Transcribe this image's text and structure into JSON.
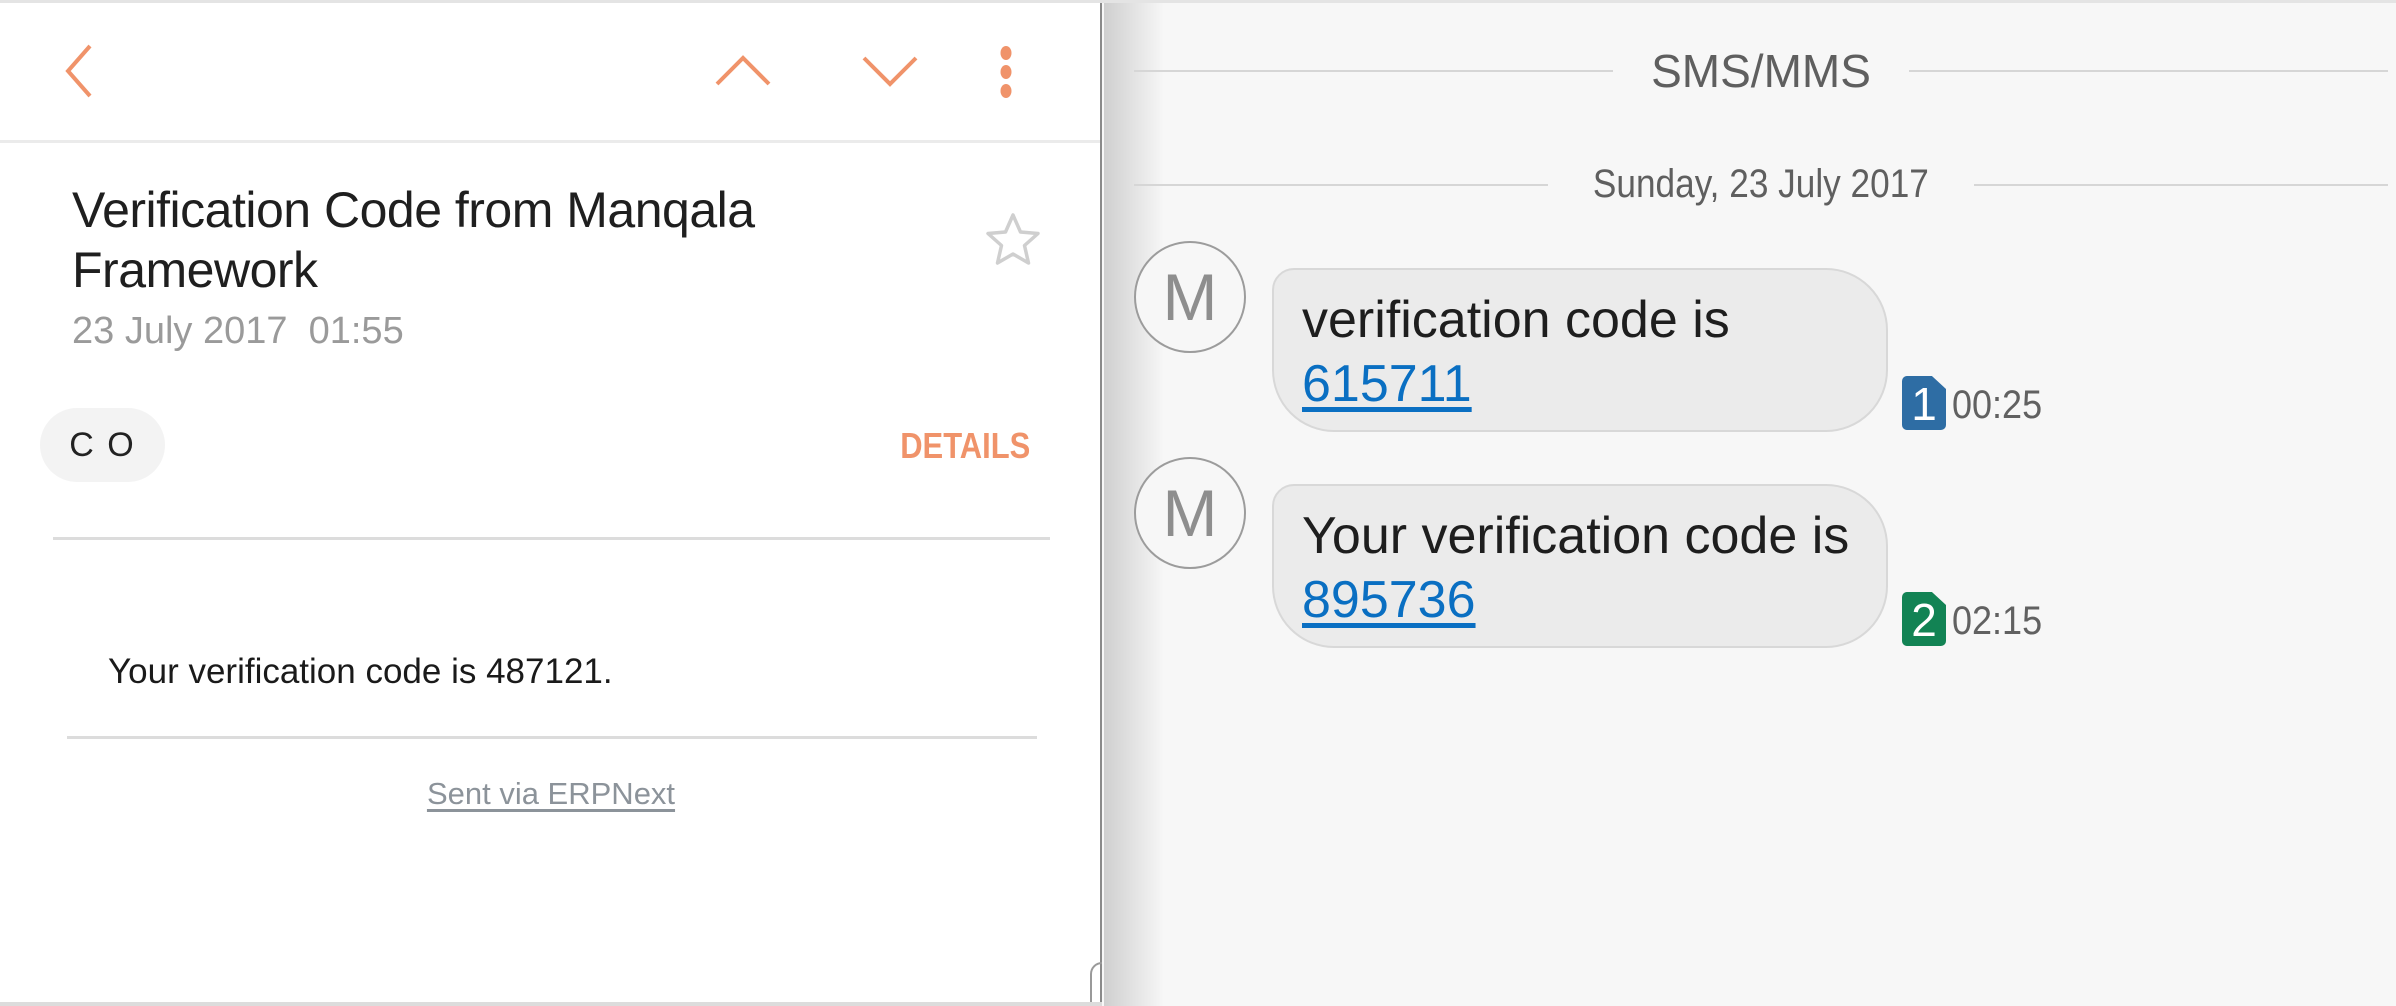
{
  "email": {
    "toolbar": {
      "back_icon": "chevron-left-icon",
      "prev_icon": "chevron-up-icon",
      "next_icon": "chevron-down-icon",
      "more_icon": "more-vert-icon"
    },
    "subject": "Verification Code from Manqala Framework",
    "date": "23 July 2017  01:55",
    "star_icon": "star-outline-icon",
    "sender_chip": "C O",
    "details_label": "DETAILS",
    "body": "Your verification code is 487121.",
    "footer_link": "Sent via ERPNext"
  },
  "messages": {
    "header": "SMS/MMS",
    "date_separator": "Sunday, 23 July 2017",
    "items": [
      {
        "avatar_initial": "M",
        "text_prefix": "verification code is ",
        "code": "615711",
        "sim": "1",
        "sim_color": "#2e6da4",
        "time": "00:25"
      },
      {
        "avatar_initial": "M",
        "text_prefix": "Your verification code is ",
        "code": "895736",
        "sim": "2",
        "sim_color": "#128354",
        "time": "02:15"
      }
    ]
  },
  "colors": {
    "accent": "#f0936a",
    "link": "#0a6fc2"
  }
}
